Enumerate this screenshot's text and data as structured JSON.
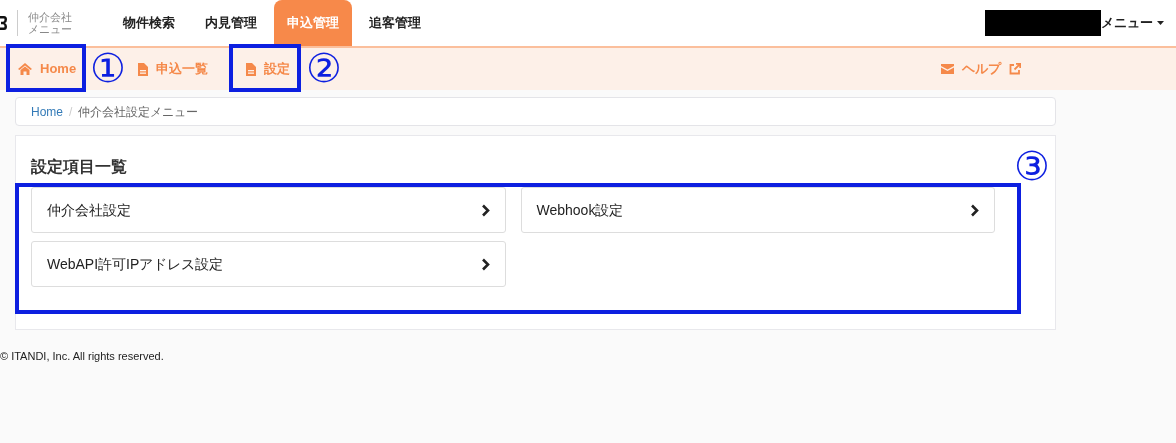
{
  "header": {
    "brand_lines": [
      "仲介会社",
      "メニュー"
    ],
    "tabs": [
      {
        "label": "物件検索",
        "selected": false
      },
      {
        "label": "内見管理",
        "selected": false
      },
      {
        "label": "申込管理",
        "selected": true
      },
      {
        "label": "追客管理",
        "selected": false
      }
    ],
    "user_menu": "メニュー"
  },
  "subnav": {
    "items": [
      {
        "label": "Home",
        "kind": "home"
      },
      {
        "label": "申込一覧",
        "kind": "doc"
      },
      {
        "label": "設定",
        "kind": "doc"
      }
    ],
    "help": "ヘルプ"
  },
  "breadcrumb": {
    "separator": "/",
    "items": [
      {
        "label": "Home",
        "kind": "link"
      },
      {
        "label": "仲介会社設定メニュー",
        "kind": "current"
      }
    ]
  },
  "panel": {
    "title": "設定項目一覧",
    "items": [
      {
        "label": "仲介会社設定"
      },
      {
        "label": "Webhook設定"
      },
      {
        "label": "WebAPI許可IPアドレス設定"
      }
    ]
  },
  "footer": "© ITANDI, Inc. All rights reserved.",
  "annotations": [
    {
      "number": "①"
    },
    {
      "number": "②"
    },
    {
      "number": "③"
    }
  ]
}
